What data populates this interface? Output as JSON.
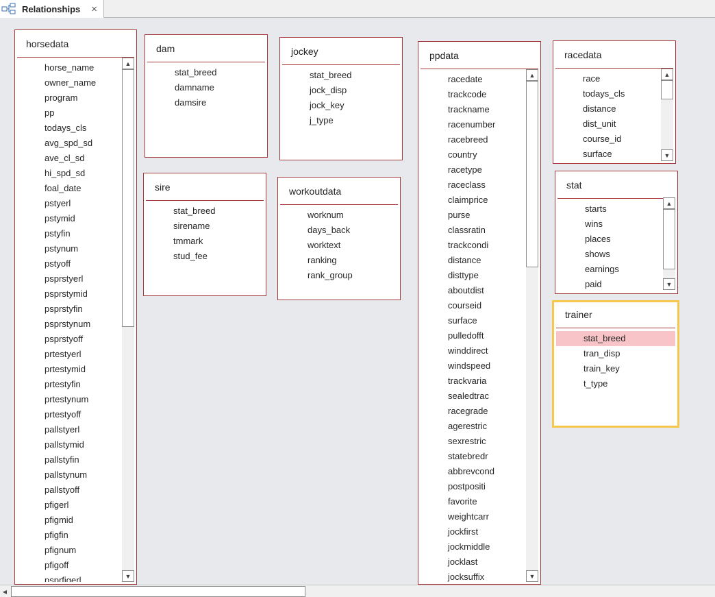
{
  "tab": {
    "title": "Relationships",
    "close": "×"
  },
  "tables": {
    "horsedata": {
      "title": "horsedata",
      "fields": [
        "horse_name",
        "owner_name",
        "program",
        "pp",
        "todays_cls",
        "avg_spd_sd",
        "ave_cl_sd",
        "hi_spd_sd",
        "foal_date",
        "pstyerl",
        "pstymid",
        "pstyfin",
        "pstynum",
        "pstyoff",
        "psprstyerl",
        "psprstymid",
        "psprstyfin",
        "psprstynum",
        "psprstyoff",
        "prtestyerl",
        "prtestymid",
        "prtestyfin",
        "prtestynum",
        "prtestyoff",
        "pallstyerl",
        "pallstymid",
        "pallstyfin",
        "pallstynum",
        "pallstyoff",
        "pfigerl",
        "pfigmid",
        "pfigfin",
        "pfignum",
        "pfigoff",
        "psprfigerl"
      ]
    },
    "dam": {
      "title": "dam",
      "fields": [
        "stat_breed",
        "damname",
        "damsire"
      ]
    },
    "sire": {
      "title": "sire",
      "fields": [
        "stat_breed",
        "sirename",
        "tmmark",
        "stud_fee"
      ]
    },
    "jockey": {
      "title": "jockey",
      "fields": [
        "stat_breed",
        "jock_disp",
        "jock_key",
        "j_type"
      ]
    },
    "workoutdata": {
      "title": "workoutdata",
      "fields": [
        "worknum",
        "days_back",
        "worktext",
        "ranking",
        "rank_group"
      ]
    },
    "ppdata": {
      "title": "ppdata",
      "fields": [
        "racedate",
        "trackcode",
        "trackname",
        "racenumber",
        "racebreed",
        "country",
        "racetype",
        "raceclass",
        "claimprice",
        "purse",
        "classratin",
        "trackcondi",
        "distance",
        "disttype",
        "aboutdist",
        "courseid",
        "surface",
        "pulledofft",
        "winddirect",
        "windspeed",
        "trackvaria",
        "sealedtrac",
        "racegrade",
        "agerestric",
        "sexrestric",
        "statebredr",
        "abbrevcond",
        "postpositi",
        "favorite",
        "weightcarr",
        "jockfirst",
        "jockmiddle",
        "jocklast",
        "jocksuffix"
      ]
    },
    "racedata": {
      "title": "racedata",
      "fields": [
        "race",
        "todays_cls",
        "distance",
        "dist_unit",
        "course_id",
        "surface"
      ]
    },
    "stat": {
      "title": "stat",
      "fields": [
        "starts",
        "wins",
        "places",
        "shows",
        "earnings",
        "paid"
      ]
    },
    "trainer": {
      "title": "trainer",
      "fields": [
        "stat_breed",
        "tran_disp",
        "train_key",
        "t_type"
      ],
      "selected_field": "stat_breed"
    }
  },
  "colors": {
    "border": "#a4373a",
    "selected_border": "#f5c84b",
    "highlight": "#f8c4c7",
    "canvas": "#e7e9ed"
  },
  "icons": {
    "tab": "relationships-icon",
    "up": "scroll-up-arrow-icon",
    "down": "scroll-down-arrow-icon",
    "left": "scroll-left-arrow-icon"
  }
}
